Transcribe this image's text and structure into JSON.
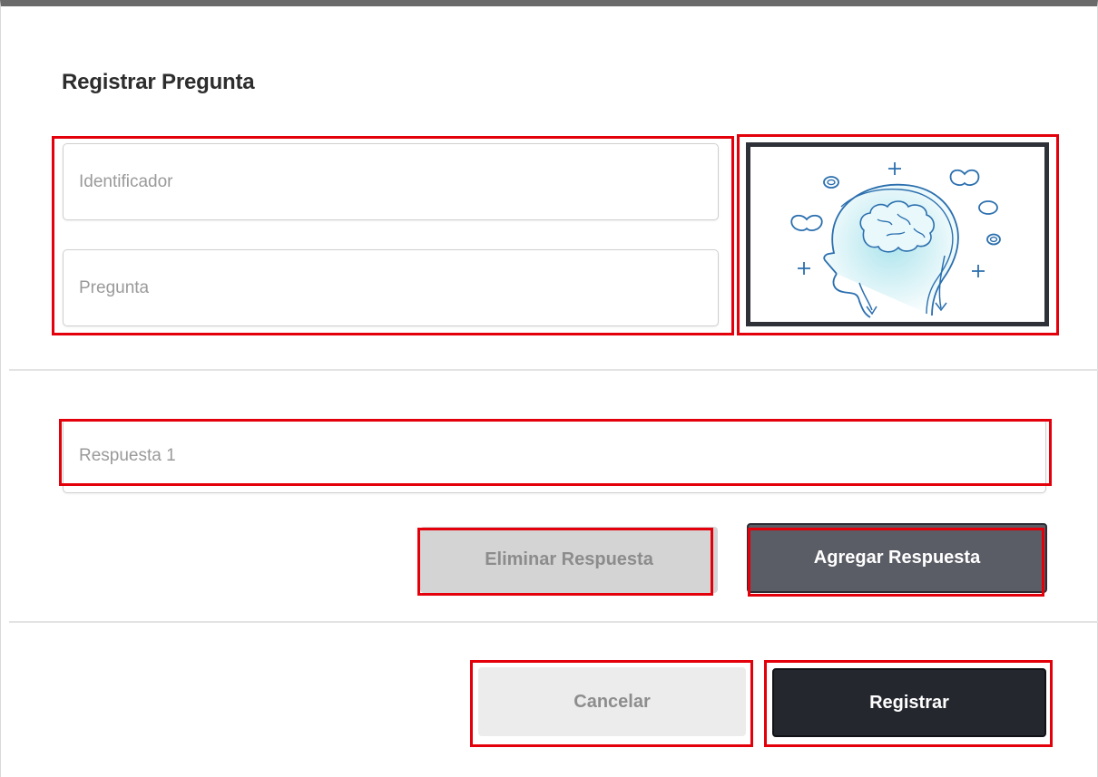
{
  "dialog": {
    "title": "Registrar Pregunta"
  },
  "form": {
    "identificador_placeholder": "Identificador",
    "identificador_value": "",
    "pregunta_placeholder": "Pregunta",
    "pregunta_value": "",
    "image_icon": "head-brain-illustration"
  },
  "answers": {
    "respuesta_1_placeholder": "Respuesta 1",
    "respuesta_1_value": "",
    "delete_label": "Eliminar Respuesta",
    "add_label": "Agregar Respuesta"
  },
  "footer": {
    "cancel_label": "Cancelar",
    "submit_label": "Registrar"
  },
  "colors": {
    "highlight": "#e3000b",
    "primary_dark": "#25272e",
    "secondary_gray": "#5b5d66",
    "illustration_stroke": "#2b6fae",
    "illustration_fill": "#a9e3ec"
  }
}
